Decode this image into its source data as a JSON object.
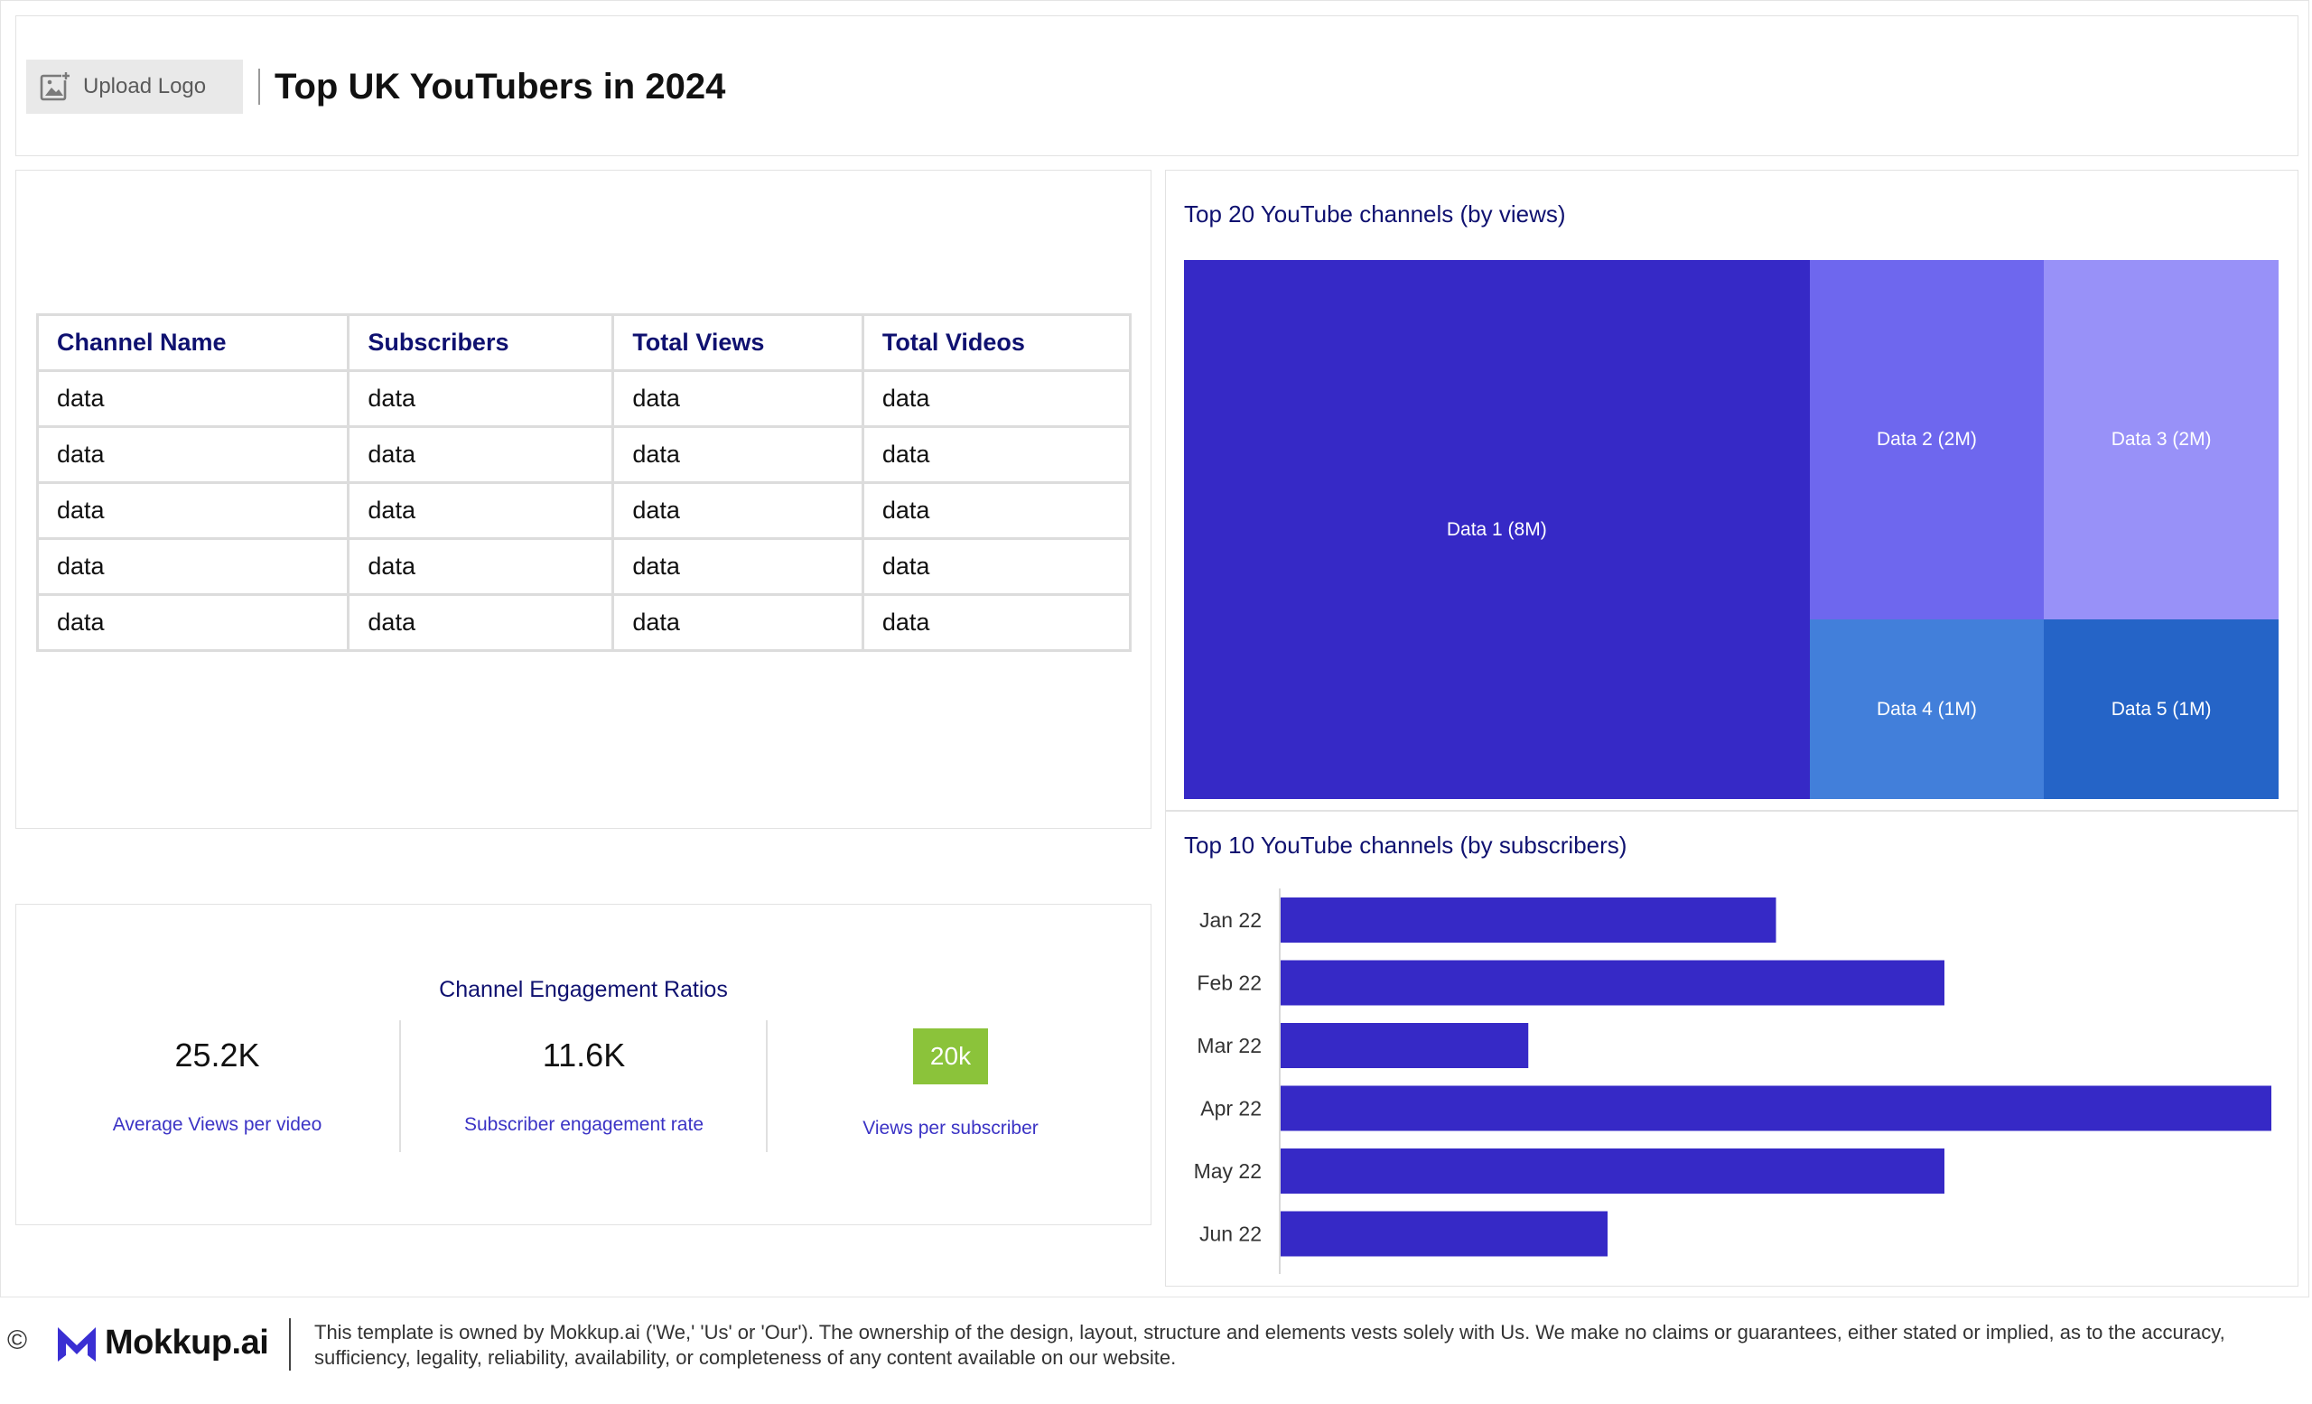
{
  "header": {
    "upload_logo_label": "Upload Logo",
    "title": "Top UK YouTubers in 2024"
  },
  "table": {
    "columns": [
      "Channel Name",
      "Subscribers",
      "Total Views",
      "Total Videos"
    ],
    "rows": [
      [
        "data",
        "data",
        "data",
        "data"
      ],
      [
        "data",
        "data",
        "data",
        "data"
      ],
      [
        "data",
        "data",
        "data",
        "data"
      ],
      [
        "data",
        "data",
        "data",
        "data"
      ],
      [
        "data",
        "data",
        "data",
        "data"
      ]
    ]
  },
  "engagement": {
    "title": "Channel Engagement Ratios",
    "kpis": [
      {
        "value": "25.2K",
        "label": "Average Views per video"
      },
      {
        "value": "11.6K",
        "label": "Subscriber engagement rate"
      },
      {
        "value": "20k",
        "label": "Views per subscriber"
      }
    ],
    "badge_color": "#8bc33a"
  },
  "colors": {
    "title_navy": "#0f1170",
    "bar_color": "#3629c6"
  },
  "chart_data": [
    {
      "type": "treemap",
      "title": "Top 20 YouTube channels (by views)",
      "items": [
        {
          "label": "Data 1 (8M)",
          "value": 8,
          "color": "#3629c6"
        },
        {
          "label": "Data 2 (2M)",
          "value": 2,
          "color": "#6e67ee"
        },
        {
          "label": "Data 3 (2M)",
          "value": 2,
          "color": "#9891f8"
        },
        {
          "label": "Data 4 (1M)",
          "value": 1,
          "color": "#427fda"
        },
        {
          "label": "Data 5 (1M)",
          "value": 1,
          "color": "#2564c7"
        }
      ]
    },
    {
      "type": "bar",
      "orientation": "horizontal",
      "title": "Top 10 YouTube channels (by subscribers)",
      "categories": [
        "Jan 22",
        "Feb 22",
        "Mar 22",
        "Apr 22",
        "May 22",
        "Jun 22"
      ],
      "values": [
        50,
        67,
        25,
        100,
        67,
        33
      ],
      "color": "#3629c6",
      "grid": false
    }
  ],
  "footer": {
    "copyright_symbol": "©",
    "brand": "Mokkup.ai",
    "disclaimer": "This template is owned by Mokkup.ai ('We,' 'Us' or 'Our'). The ownership of the design, layout, structure and elements vests solely with Us. We make no claims or guarantees, either stated or implied, as to the accuracy, sufficiency, legality, reliability, availability, or completeness of any content available on our website."
  }
}
